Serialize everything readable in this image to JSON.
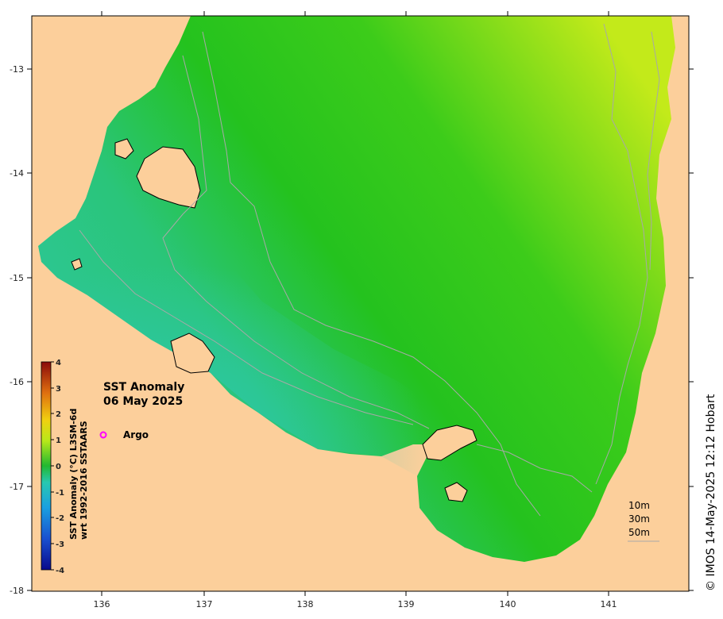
{
  "map": {
    "title_line1": "SST Anomaly",
    "title_line2": "06 May 2025",
    "x_ticks": [
      "136",
      "137",
      "138",
      "139",
      "140",
      "141"
    ],
    "y_ticks": [
      "-13",
      "-14",
      "-15",
      "-16",
      "-17",
      "-18"
    ],
    "colorbar": {
      "title_line1": "SST Anomaly (°C) L3SM-6d",
      "title_line2": "wrt 1992-2016 SSTAARS",
      "ticks": [
        "4",
        "3",
        "2",
        "1",
        "0",
        "-1",
        "-2",
        "-3",
        "-4"
      ],
      "range": [
        -4,
        4
      ]
    },
    "legend": {
      "argo_label": "Argo",
      "argo_marker_color": "#ff00ff"
    },
    "depth_labels": [
      "10m",
      "30m",
      "50m"
    ],
    "credit": "© IMOS 14-May-2025 12:12 Hobart",
    "colors": {
      "land": "#fccf9b",
      "ocean_cyan": "#2ec7a6",
      "ocean_green": "#27c21a",
      "ocean_yellow": "#b9e81a"
    }
  }
}
